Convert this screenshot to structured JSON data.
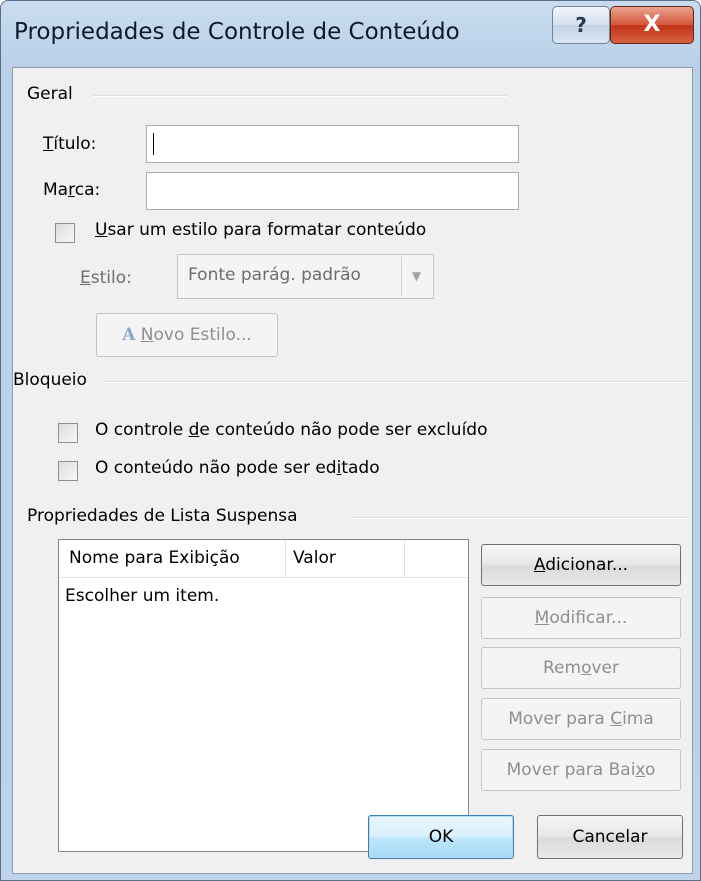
{
  "window": {
    "title": "Propriedades de Controle de Conteúdo",
    "help_label": "?",
    "close_label": "X"
  },
  "general": {
    "group_label": "Geral",
    "title_label_u": "T",
    "title_label_rest": "ítulo:",
    "title_value": "",
    "tag_label_pre": "Ma",
    "tag_label_u": "r",
    "tag_label_post": "ca:",
    "tag_value": "",
    "use_style_u": "U",
    "use_style_rest": "sar um estilo para formatar conteúdo",
    "use_style_checked": false,
    "style_label_u": "E",
    "style_label_rest": "stilo:",
    "style_value": "Fonte parág. padrão",
    "new_style_icon_text": "A",
    "new_style_u": "N",
    "new_style_rest": "ovo Estilo..."
  },
  "locking": {
    "group_label": "Bloqueio",
    "cannot_delete_pre": "O controle ",
    "cannot_delete_u": "d",
    "cannot_delete_post": "e conteúdo não pode ser excluído",
    "cannot_delete_checked": false,
    "cannot_edit_pre": "O conteúdo não pode ser ed",
    "cannot_edit_u": "i",
    "cannot_edit_post": "tado",
    "cannot_edit_checked": false
  },
  "dropdown": {
    "group_label": "Propriedades de Lista Suspensa",
    "columns": [
      "Nome para Exibição",
      "Valor"
    ],
    "rows": [
      {
        "display": "Escolher um item.",
        "value": ""
      }
    ],
    "add_u": "A",
    "add_rest": "dicionar...",
    "modify_u": "M",
    "modify_rest": "odificar...",
    "remove_pre": "Rem",
    "remove_u": "o",
    "remove_post": "ver",
    "move_up_pre": "Mover para ",
    "move_up_u": "C",
    "move_up_post": "ima",
    "move_down_pre": "Mover para Bai",
    "move_down_u": "x",
    "move_down_post": "o"
  },
  "footer": {
    "ok_label": "OK",
    "cancel_label": "Cancelar"
  }
}
